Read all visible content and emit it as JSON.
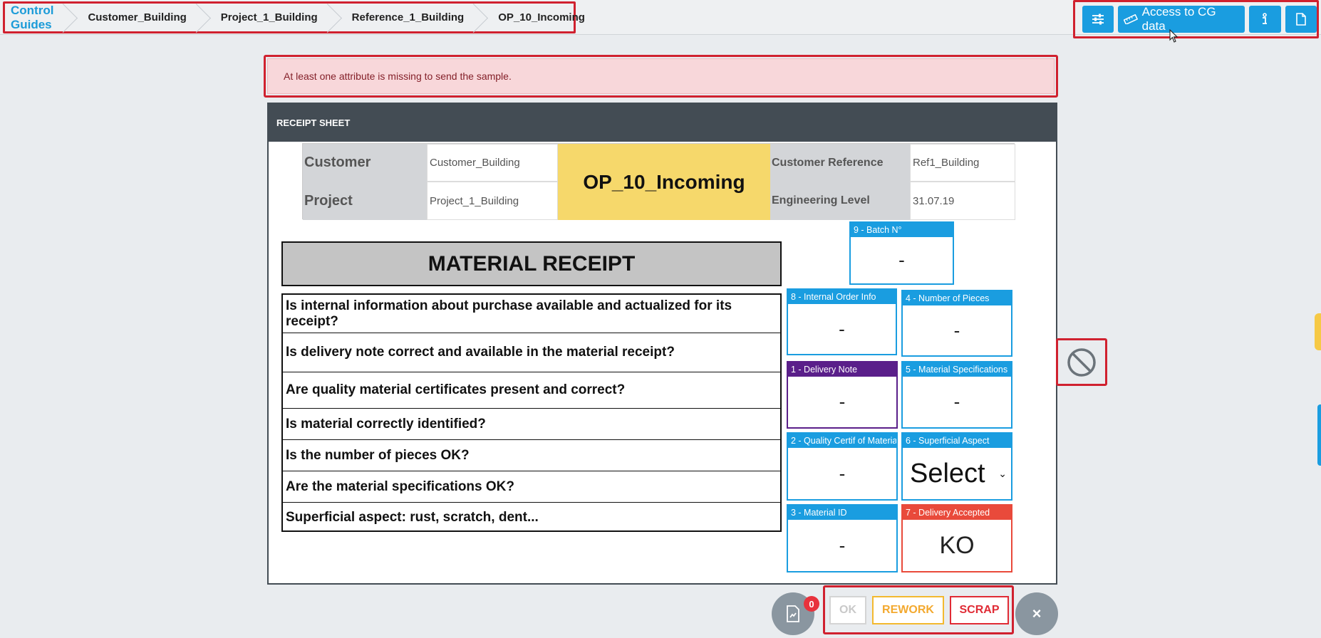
{
  "breadcrumb": {
    "items": [
      {
        "label": "Control Guides"
      },
      {
        "label": "Customer_Building"
      },
      {
        "label": "Project_1_Building"
      },
      {
        "label": "Reference_1_Building"
      },
      {
        "label": "OP_10_Incoming"
      }
    ]
  },
  "toolbar": {
    "settings_icon": "sliders-icon",
    "access_label": "Access to CG data",
    "access_icon": "ruler-icon",
    "info_icon": "info-icon",
    "document_icon": "document-icon"
  },
  "alert": {
    "message": "At least one attribute is missing to send the sample."
  },
  "sheet": {
    "title": "RECEIPT SHEET",
    "info": {
      "customer_label": "Customer",
      "customer_value": "Customer_Building",
      "project_label": "Project",
      "project_value": "Project_1_Building",
      "operation": "OP_10_Incoming",
      "customer_reference_label": "Customer Reference",
      "customer_reference_value": "Ref1_Building",
      "engineering_level_label": "Engineering Level",
      "engineering_level_value": "31.07.19"
    },
    "section_title": "MATERIAL RECEIPT",
    "questions": [
      "Is internal information about purchase available and actualized for its receipt?",
      "Is delivery note correct and available in the material receipt?",
      "Are quality material certificates present and correct?",
      "Is material correctly identified?",
      "Is the number of pieces OK?",
      "Are the material specifications OK?",
      "Superficial aspect: rust, scratch, dent..."
    ],
    "attributes": {
      "batch": {
        "label": "9 - Batch N°",
        "value": "-"
      },
      "internal_order": {
        "label": "8 - Internal Order Info",
        "value": "-"
      },
      "number_of_pieces": {
        "label": "4 - Number of Pieces",
        "value": "-"
      },
      "delivery_note": {
        "label": "1 - Delivery Note",
        "value": "-"
      },
      "material_specifications": {
        "label": "5 - Material Specifications",
        "value": "-"
      },
      "quality_certif": {
        "label": "2 - Quality Certif of Materia",
        "value": "-"
      },
      "superficial_aspect": {
        "label": "6 - Superficial Aspect",
        "value": "Select"
      },
      "material_id": {
        "label": "3 - Material ID",
        "value": "-"
      },
      "delivery_accepted": {
        "label": "7 - Delivery Accepted",
        "value": "KO"
      }
    }
  },
  "side": {
    "block_icon": "prohibited-icon"
  },
  "actions": {
    "report_badge": "0",
    "ok_label": "OK",
    "rework_label": "REWORK",
    "scrap_label": "SCRAP",
    "close_label": "×"
  },
  "colors": {
    "primary": "#1a9de0",
    "alert_bg": "#f8d7da",
    "op_highlight": "#f6d86b",
    "delivery_note": "#5a1f8a",
    "delivery_accepted": "#e94a3b",
    "rework": "#f3a92f",
    "scrap": "#e02b35"
  }
}
